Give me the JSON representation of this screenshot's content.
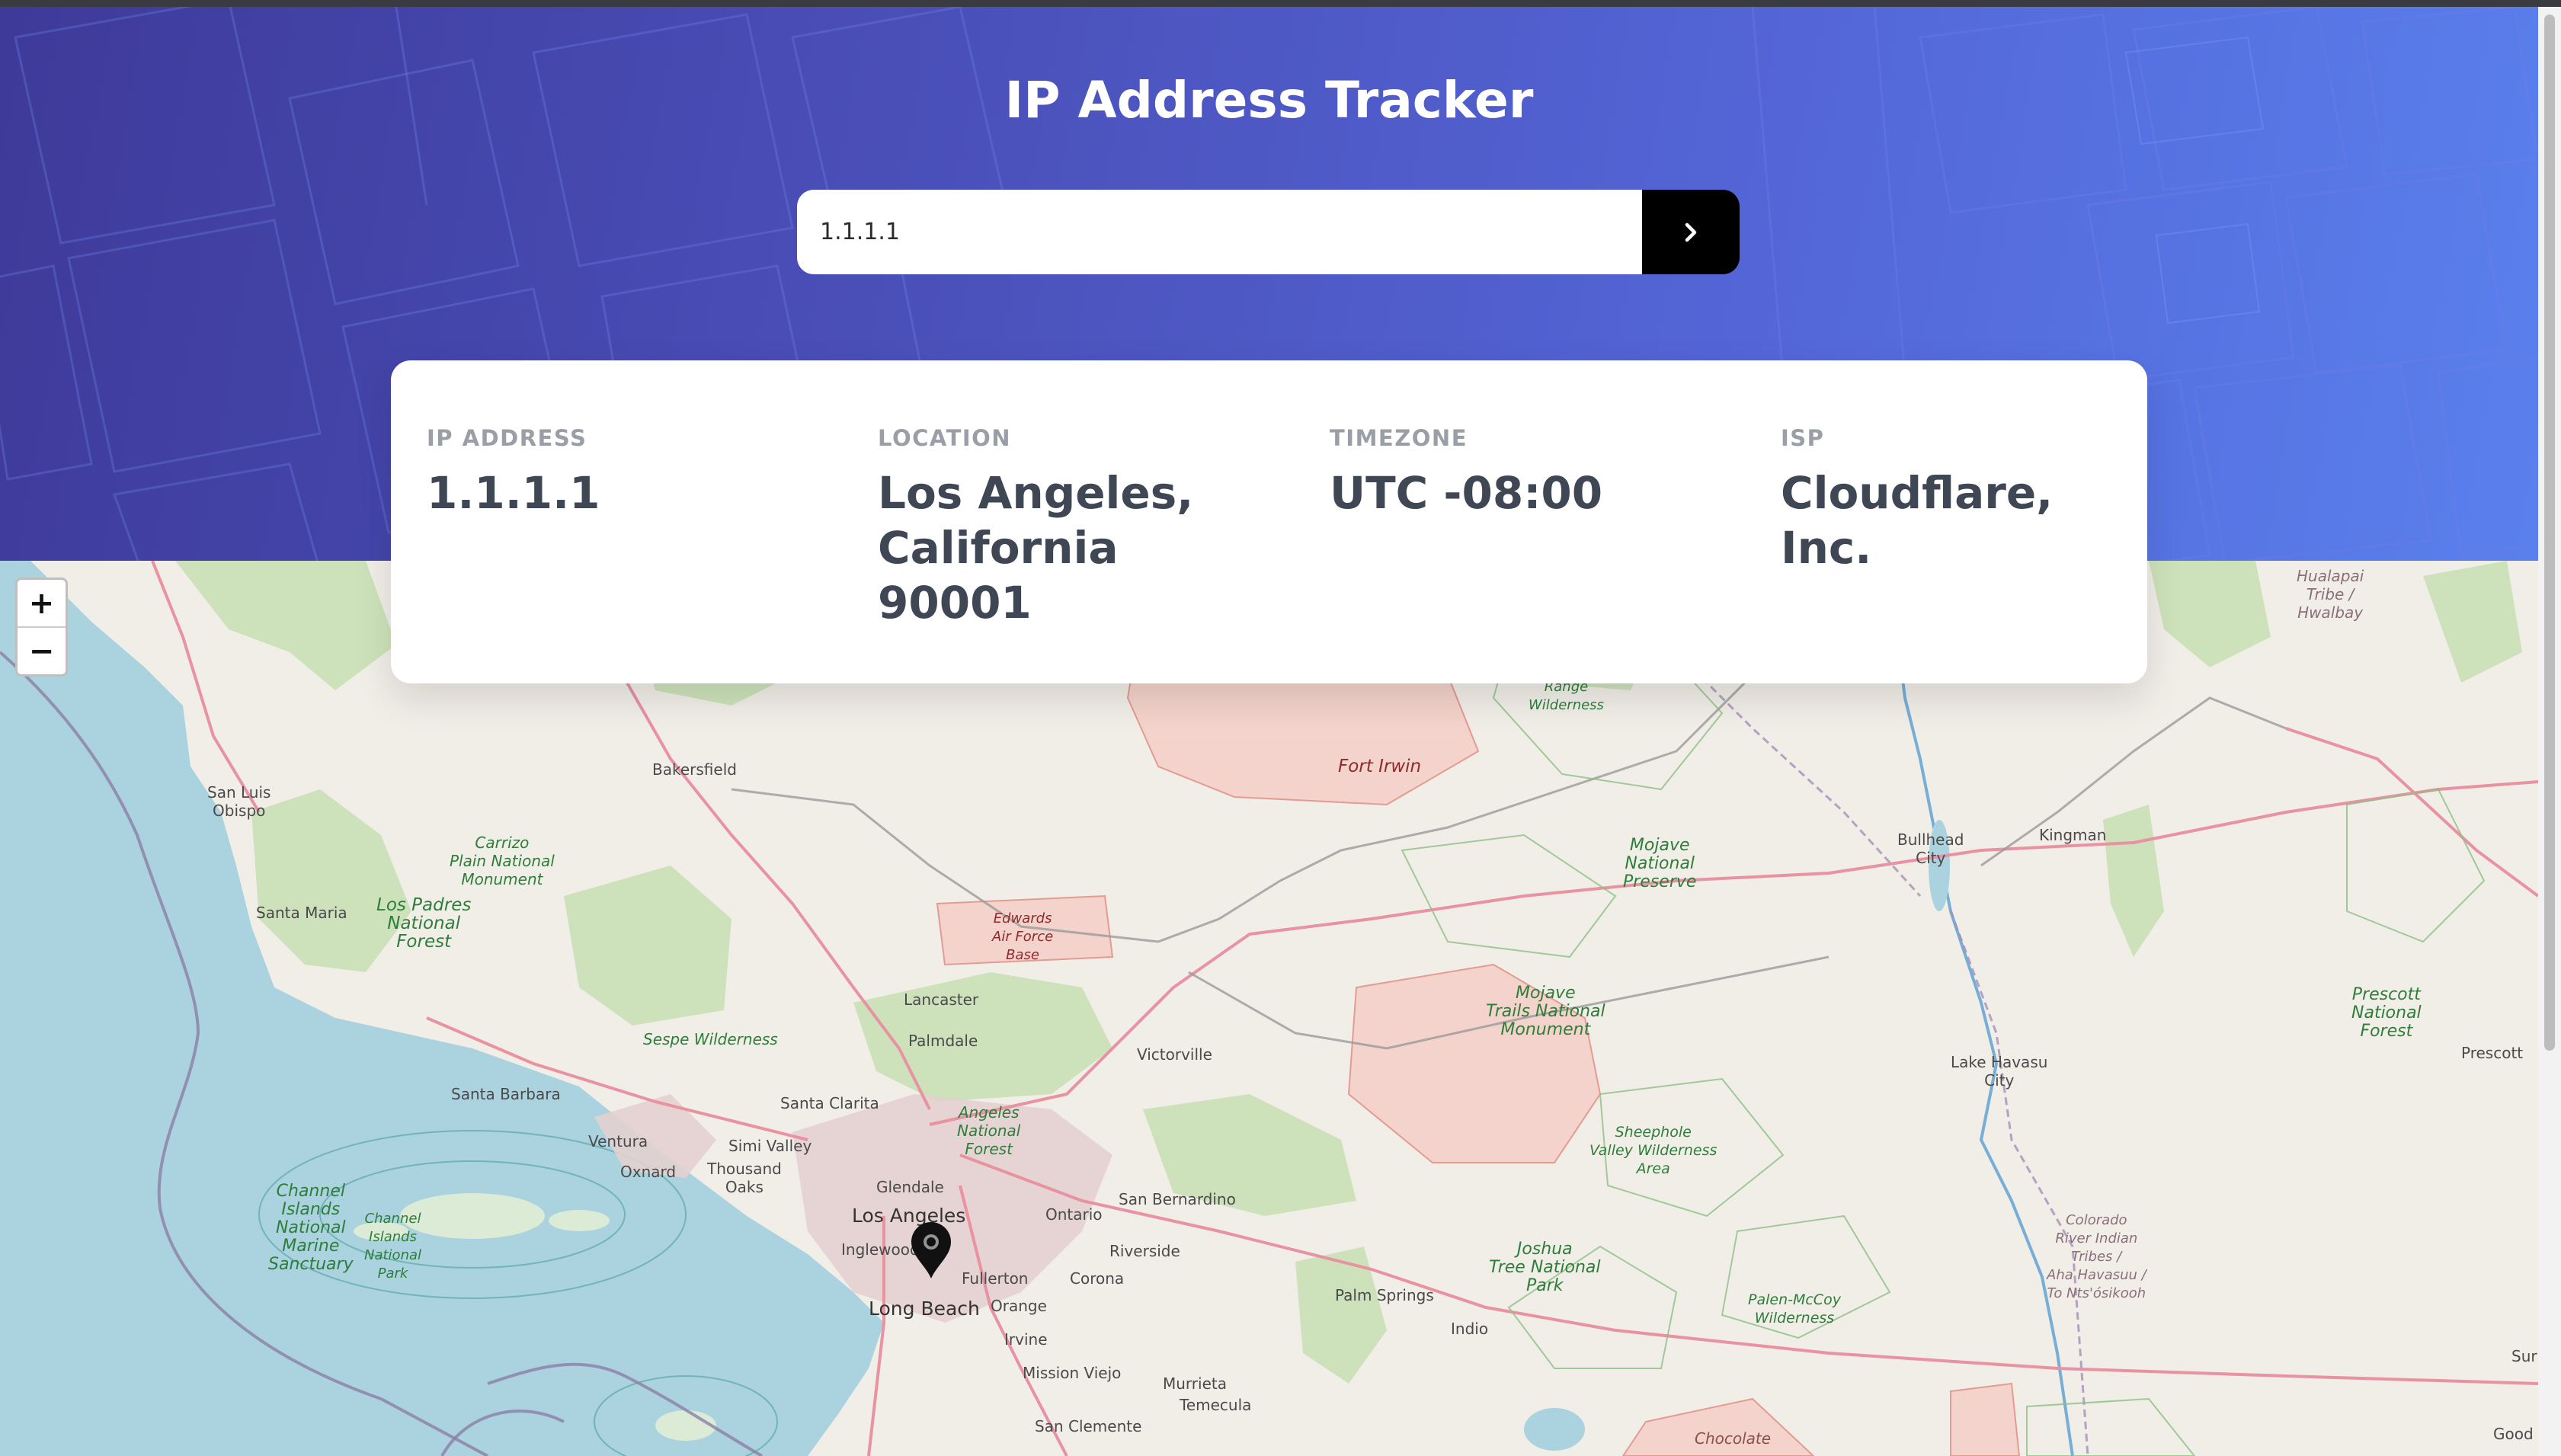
{
  "header": {
    "title": "IP Address Tracker"
  },
  "search": {
    "value": "1.1.1.1",
    "submit_icon": "chevron-right-icon"
  },
  "info": {
    "ip_label": "IP ADDRESS",
    "ip_value": "1.1.1.1",
    "location_label": "LOCATION",
    "location_value": "Los Angeles, California 90001",
    "timezone_label": "TIMEZONE",
    "timezone_value": "UTC -08:00",
    "isp_label": "ISP",
    "isp_value": "Cloudflare, Inc."
  },
  "map": {
    "zoom_in": "+",
    "zoom_out": "−",
    "marker_icon": "location-pin-icon",
    "places": {
      "bakersfield": "Bakersfield",
      "san_luis_obispo": "San Luis\nObispo",
      "santa_maria": "Santa Maria",
      "santa_barbara": "Santa Barbara",
      "ventura": "Ventura",
      "oxnard": "Oxnard",
      "simi_valley": "Simi Valley",
      "thousand_oaks": "Thousand\nOaks",
      "santa_clarita": "Santa Clarita",
      "lancaster": "Lancaster",
      "palmdale": "Palmdale",
      "victorville": "Victorville",
      "glendale": "Glendale",
      "los_angeles": "Los Angeles",
      "inglewood": "Inglewood",
      "long_beach": "Long Beach",
      "fullerton": "Fullerton",
      "orange": "Orange",
      "irvine": "Irvine",
      "mission_viejo": "Mission Viejo",
      "san_clemente": "San Clemente",
      "murrieta": "Murrieta",
      "temecula": "Temecula",
      "ontario": "Ontario",
      "san_bernardino": "San Bernardino",
      "riverside": "Riverside",
      "corona": "Corona",
      "palm_springs": "Palm Springs",
      "indio": "Indio",
      "bullhead_city": "Bullhead\nCity",
      "kingman": "Kingman",
      "lake_havasu_city": "Lake Havasu\nCity",
      "prescott": "Prescott",
      "good": "Good",
      "surp": "Surp"
    },
    "parks": {
      "carrizo": "Carrizo\nPlain National\nMonument",
      "los_padres": "Los Padres\nNational\nForest",
      "sespe": "Sespe Wilderness",
      "angeles": "Angeles\nNational\nForest",
      "channel_sanctuary": "Channel\nIslands\nNational\nMarine\nSanctuary",
      "channel_park": "Channel\nIslands\nNational\nPark",
      "mojave_preserve": "Mojave\nNational\nPreserve",
      "mojave_trails": "Mojave\nTrails National\nMonument",
      "sheephole": "Sheephole\nValley Wilderness\nArea",
      "joshua_tree": "Joshua\nTree National\nPark",
      "palen_mccoy": "Palen-McCoy\nWilderness",
      "prescott_forest": "Prescott\nNational\nForest",
      "kingston": "Range\nWilderness",
      "hualapai": "Hualapai\nTribe /\nHwalbay",
      "colorado_river": "Colorado\nRiver Indian\nTribes /\nAha Havasuu /\nTo Nts'ósikooh",
      "chocolate": "Chocolate"
    },
    "military": {
      "fort_irwin": "Fort Irwin",
      "edwards": "Edwards\nAir Force\nBase"
    }
  }
}
